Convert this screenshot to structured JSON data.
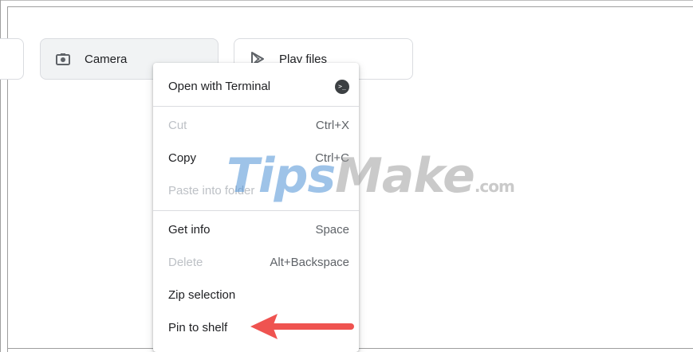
{
  "tiles": {
    "camera": {
      "label": "Camera",
      "icon": "camera-icon"
    },
    "play_files": {
      "label": "Play files",
      "icon": "play-store-icon"
    }
  },
  "context_menu": {
    "open_with_terminal": {
      "label": "Open with Terminal",
      "icon": "terminal-icon",
      "badge": ">_"
    },
    "cut": {
      "label": "Cut",
      "shortcut": "Ctrl+X",
      "disabled": true
    },
    "copy": {
      "label": "Copy",
      "shortcut": "Ctrl+C",
      "disabled": false
    },
    "paste_into_folder": {
      "label": "Paste into folder",
      "disabled": true
    },
    "get_info": {
      "label": "Get info",
      "shortcut": "Space",
      "disabled": false
    },
    "delete": {
      "label": "Delete",
      "shortcut": "Alt+Backspace",
      "disabled": true
    },
    "zip_selection": {
      "label": "Zip selection",
      "disabled": false
    },
    "pin_to_shelf": {
      "label": "Pin to shelf",
      "disabled": false
    }
  },
  "watermark": {
    "part1": "Tips",
    "part2": "Make",
    "part3": ".com"
  },
  "colors": {
    "arrow": "#ef5350",
    "menu_text": "#202124",
    "disabled_text": "#bdc1c6",
    "tile_selected": "#f1f3f4"
  }
}
